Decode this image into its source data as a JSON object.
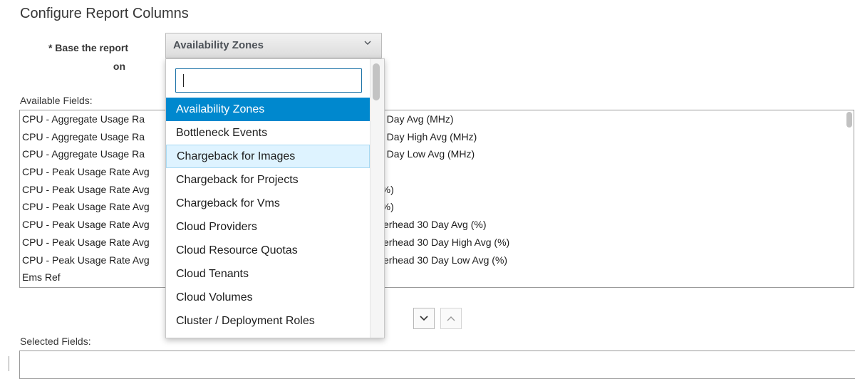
{
  "page": {
    "title": "Configure Report Columns"
  },
  "base": {
    "label_line1": "* Base the report",
    "label_line2": "on",
    "selected_value": "Availability Zones"
  },
  "available": {
    "label": "Available Fields:",
    "rows": [
      "CPU - Aggregate Usage Ra",
      "CPU - Aggregate Usage Ra",
      "CPU - Aggregate Usage Ra",
      "CPU - Peak Usage Rate Avg",
      "CPU - Peak Usage Rate Avg",
      "CPU - Peak Usage Rate Avg",
      "CPU - Peak Usage Rate Avg",
      "CPU - Peak Usage Rate Avg",
      "CPU - Peak Usage Rate Avg",
      "Ems Ref"
    ],
    "rows_right": [
      "0 Day Avg (MHz)",
      "0 Day High Avg (MHz)",
      "0 Day Low Avg (MHz)",
      "",
      "(%)",
      "(%)",
      "verhead 30 Day Avg (%)",
      "verhead 30 Day High Avg (%)",
      "verhead 30 Day Low Avg (%)",
      ""
    ]
  },
  "selected": {
    "label": "Selected Fields:"
  },
  "move_buttons": {
    "down_icon": "chevron-down-icon",
    "up_icon": "chevron-up-icon"
  },
  "dropdown": {
    "search_value": "",
    "options": [
      "Availability Zones",
      "Bottleneck Events",
      "Chargeback for Images",
      "Chargeback for Projects",
      "Chargeback for Vms",
      "Cloud Providers",
      "Cloud Resource Quotas",
      "Cloud Tenants",
      "Cloud Volumes",
      "Cluster / Deployment Roles"
    ],
    "active_index": 0,
    "hover_index": 2
  },
  "colors": {
    "accent": "#0088ce",
    "hover": "#def3ff",
    "text": "#363636"
  }
}
